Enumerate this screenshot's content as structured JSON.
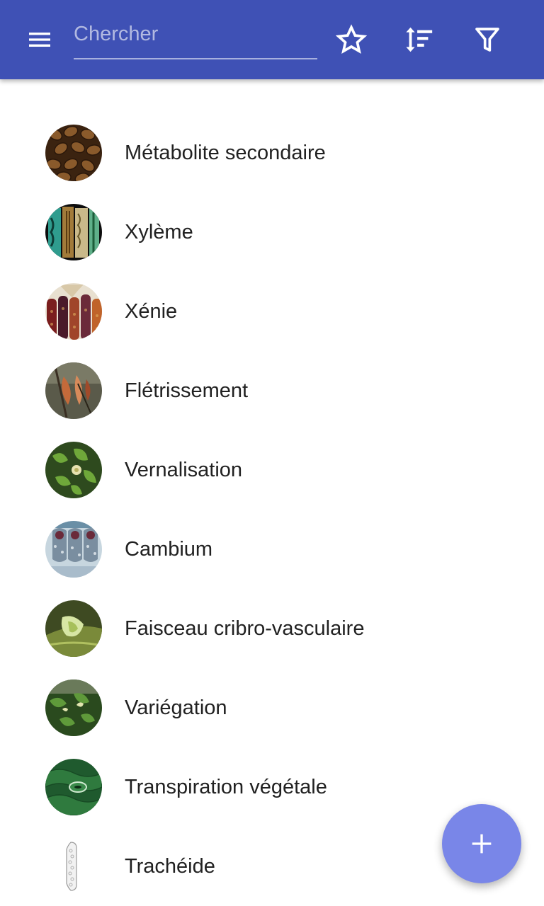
{
  "appbar": {
    "background_color": "#3f51b5",
    "menu_icon": "menu-icon",
    "search": {
      "placeholder": "Chercher",
      "value": ""
    },
    "actions": [
      {
        "name": "favorites",
        "icon": "star-outline-icon"
      },
      {
        "name": "sort",
        "icon": "sort-icon"
      },
      {
        "name": "filter",
        "icon": "filter-icon"
      }
    ]
  },
  "list": {
    "items": [
      {
        "label": "Métabolite secondaire",
        "thumbnail": "coffee-beans-image"
      },
      {
        "label": "Xylème",
        "thumbnail": "xylem-cells-image"
      },
      {
        "label": "Xénie",
        "thumbnail": "colored-corn-image"
      },
      {
        "label": "Flétrissement",
        "thumbnail": "wilted-leaves-image"
      },
      {
        "label": "Vernalisation",
        "thumbnail": "green-plant-image"
      },
      {
        "label": "Cambium",
        "thumbnail": "stem-cross-section-image"
      },
      {
        "label": "Faisceau cribro-vasculaire",
        "thumbnail": "vascular-bundle-image"
      },
      {
        "label": "Variégation",
        "thumbnail": "variegated-leaves-image"
      },
      {
        "label": "Transpiration végétale",
        "thumbnail": "leaf-stoma-image"
      },
      {
        "label": "Trachéide",
        "thumbnail": "tracheid-cell-image"
      }
    ]
  },
  "fab": {
    "icon": "plus-icon",
    "color": "#7986e8"
  }
}
